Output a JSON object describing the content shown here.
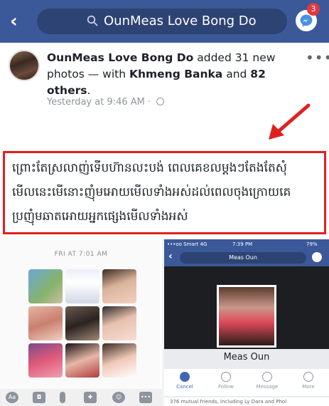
{
  "topbar": {
    "search_text": "OunMeas Love Bong Do",
    "messenger_badge": "3",
    "color": "#3b5998"
  },
  "post": {
    "author": "OunMeas Love Bong Do",
    "action_text": " added 31 new photos — with ",
    "tagged_user": "Khmeng Banka",
    "and_text": " and ",
    "others_text": "82 others",
    "period": ".",
    "timestamp": "Yesterday at 9:46 AM · ",
    "more_label": "•••",
    "caption_lines": [
      "ព្រោះតែស្រលាញ់ទើបហ៊ានលះបង់ ពេលគេខលម្ដងៗតែងតែសុំ",
      "មើលនេះមើនោះញុំមអោយមើលទាំងអស់ដល់ពេលចុងក្រោយគេ",
      "ប្រញុំមឆាតអោយអ្នកផ្សេងមើលទាំងអស់"
    ],
    "highlight_color": "#e02020"
  },
  "left_screenshot": {
    "date_header": "FRI AT 7:01 AM",
    "chat_icons": [
      "Aa",
      "camera-icon",
      "mic-icon",
      "game-icon",
      "emoji-icon",
      "more-icon"
    ],
    "aa_label": "Aa"
  },
  "right_screenshot": {
    "status_left": "•••oo Smart  4G",
    "status_time": "7:39 PM",
    "status_right": "79%",
    "search_text": "Meas Oun",
    "profile_name": "Meas Oun",
    "actions": [
      {
        "label": "Cancel"
      },
      {
        "label": "Follow"
      },
      {
        "label": "Message"
      },
      {
        "label": "More"
      }
    ],
    "mutual_text": "376 mutual friends, including Ly Dara and Phol"
  }
}
